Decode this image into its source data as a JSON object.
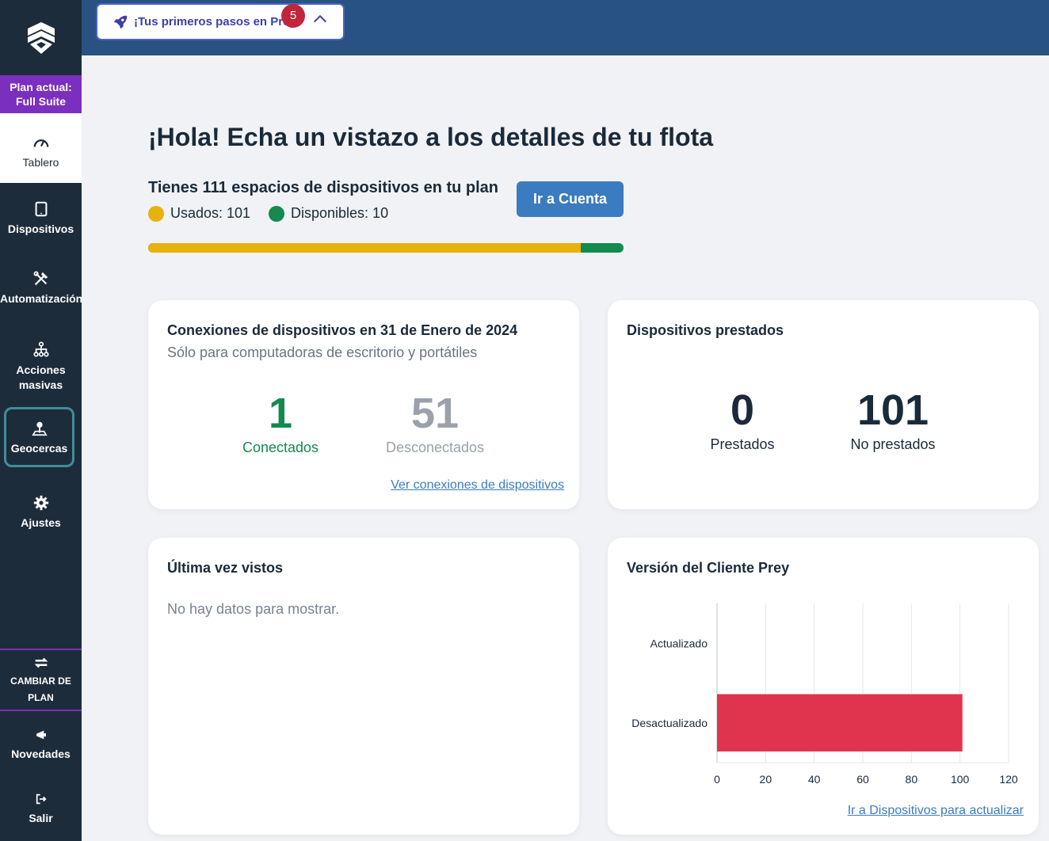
{
  "sidebar": {
    "plan_label_line1": "Plan actual:",
    "plan_label_line2": "Full Suite",
    "items": [
      {
        "label": "Tablero",
        "icon": "gauge-icon"
      },
      {
        "label": "Dispositivos",
        "icon": "tablet-icon"
      },
      {
        "label": "Automatización",
        "icon": "tools-icon"
      },
      {
        "label_line1": "Acciones",
        "label_line2": "masivas",
        "icon": "hierarchy-icon"
      },
      {
        "label": "Geocercas",
        "icon": "map-pin-icon"
      },
      {
        "label": "Ajustes",
        "icon": "gear-icon"
      }
    ],
    "change_plan_line1": "CAMBIAR DE",
    "change_plan_line2": "PLAN",
    "news_label": "Novedades",
    "logout_label": "Salir"
  },
  "topbar": {
    "first_steps_label": "¡Tus primeros pasos en Prey!",
    "first_steps_count": "5"
  },
  "main": {
    "greeting": "¡Hola! Echa un vistazo a los detalles de tu flota",
    "spaces_text": "Tienes 111 espacios de dispositivos en tu plan",
    "used_label": "Usados: 101",
    "available_label": "Disponibles: 10",
    "used_fraction": 0.91,
    "go_account_button": "Ir a Cuenta",
    "colors": {
      "used": "#e8b10c",
      "available": "#138a4e",
      "connected": "#138a4e",
      "disconnected": "#9aa1ab"
    }
  },
  "connections_card": {
    "title": "Conexiones de dispositivos en 31 de Enero de 2024",
    "subtitle": "Sólo para computadoras de escritorio y portátiles",
    "connected_value": "1",
    "connected_label": "Conectados",
    "disconnected_value": "51",
    "disconnected_label": "Desconectados",
    "link": "Ver conexiones de dispositivos"
  },
  "loaned_card": {
    "title": "Dispositivos prestados",
    "loaned_value": "0",
    "loaned_label": "Prestados",
    "not_loaned_value": "101",
    "not_loaned_label": "No prestados"
  },
  "last_seen_card": {
    "title": "Última vez vistos",
    "empty_text": "No hay datos para mostrar."
  },
  "client_version_card": {
    "title": "Versión del Cliente Prey",
    "link": "Ir a Dispositivos para actualizar"
  },
  "chart_data": {
    "type": "bar",
    "orientation": "horizontal",
    "categories": [
      "Actualizado",
      "Desactualizado"
    ],
    "values": [
      0,
      101
    ],
    "xlim": [
      0,
      120
    ],
    "xticks": [
      0,
      20,
      40,
      60,
      80,
      100,
      120
    ],
    "title": "",
    "xlabel": "",
    "ylabel": "",
    "grid": true,
    "bar_color": "#e0344e"
  }
}
